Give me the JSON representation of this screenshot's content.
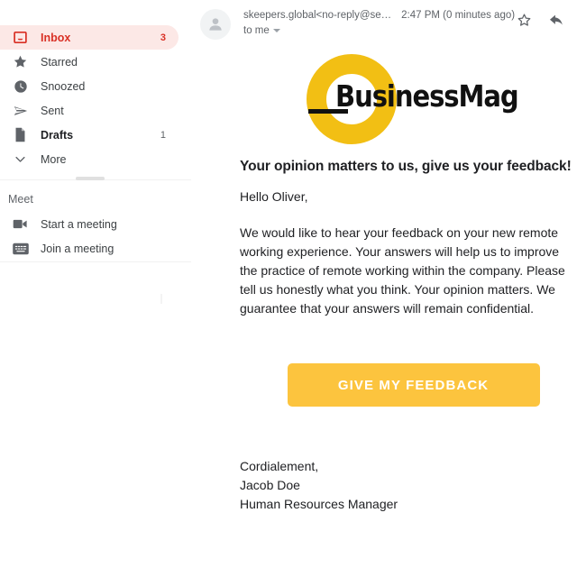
{
  "sidebar": {
    "nav_items": [
      {
        "label": "Inbox",
        "count": "3",
        "icon": "inbox-icon",
        "active": true
      },
      {
        "label": "Starred",
        "count": "",
        "icon": "star-icon",
        "active": false
      },
      {
        "label": "Snoozed",
        "count": "",
        "icon": "clock-icon",
        "active": false
      },
      {
        "label": "Sent",
        "count": "",
        "icon": "send-icon",
        "active": false
      },
      {
        "label": "Drafts",
        "count": "1",
        "icon": "document-icon",
        "active": false
      },
      {
        "label": "More",
        "count": "",
        "icon": "chevron-down-icon",
        "active": false
      }
    ],
    "meet_header": "Meet",
    "meet_items": [
      {
        "label": "Start a meeting",
        "icon": "video-camera-icon"
      },
      {
        "label": "Join a meeting",
        "icon": "keyboard-icon"
      }
    ]
  },
  "header": {
    "sender": "skeepers.global<no-reply@se…",
    "timestamp": "2:47 PM (0 minutes ago)",
    "recipient": "to me",
    "actions": {
      "star": "star-icon",
      "reply": "reply-icon",
      "more": "more-vertical-icon"
    }
  },
  "email": {
    "logo_text": "BusinessMag",
    "headline": "Your opinion matters to us, give us your feedback!",
    "greeting": "Hello Oliver,",
    "paragraph": "We would like to hear your feedback on your new remote working experience. Your answers will help us to improve the practice of remote working within the company. Please tell us honestly what you think. Your opinion matters. We guarantee that your answers will remain confidential.",
    "cta_label": "GIVE MY FEEDBACK",
    "signature": {
      "closing": "Cordialement,",
      "name": "Jacob Doe",
      "title": "Human Resources Manager"
    }
  },
  "colors": {
    "accent_red": "#d93025",
    "active_bg": "#fce8e6",
    "brand_yellow": "#f2bf14",
    "cta_yellow": "#fcc43e",
    "text_primary": "#202124",
    "text_secondary": "#5f6368"
  }
}
